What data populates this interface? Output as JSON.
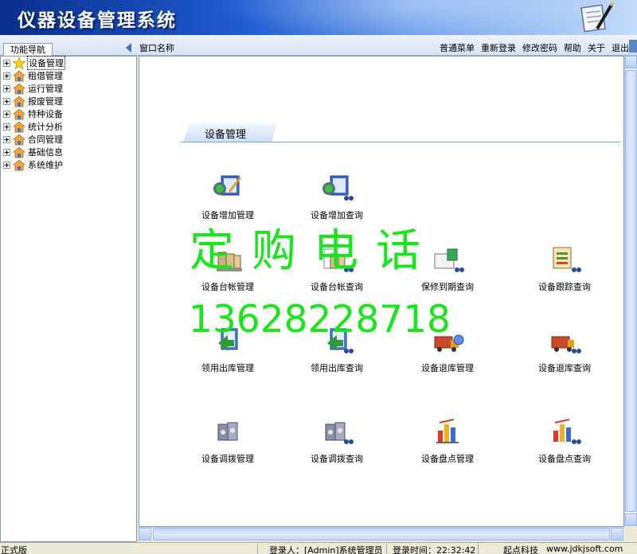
{
  "header": {
    "title": "仪器设备管理系统"
  },
  "topbar": {
    "nav_tab": "功能导航",
    "window_name": "窗口名称",
    "menu": [
      "普通菜单",
      "重新登录",
      "修改密码",
      "帮助",
      "关于",
      "退出"
    ]
  },
  "sidebar": {
    "items": [
      {
        "label": "设备管理",
        "icon": "star-icon"
      },
      {
        "label": "租借管理",
        "icon": "home-icon"
      },
      {
        "label": "运行管理",
        "icon": "home-icon"
      },
      {
        "label": "报废管理",
        "icon": "home-icon"
      },
      {
        "label": "特种设备",
        "icon": "home-icon"
      },
      {
        "label": "统计分析",
        "icon": "home-icon"
      },
      {
        "label": "合同管理",
        "icon": "home-icon"
      },
      {
        "label": "基础信息",
        "icon": "home-icon"
      },
      {
        "label": "系统维护",
        "icon": "home-icon"
      }
    ]
  },
  "main": {
    "section_title": "设备管理",
    "tiles": [
      {
        "label": "设备增加管理",
        "icon": "device-add-icon"
      },
      {
        "label": "设备增加查询",
        "icon": "device-add-query-icon"
      },
      {
        "label": "设备台帐管理",
        "icon": "ledger-icon"
      },
      {
        "label": "设备台帐查询",
        "icon": "ledger-query-icon"
      },
      {
        "label": "保修到期查询",
        "icon": "warranty-query-icon"
      },
      {
        "label": "设备跟踪查询",
        "icon": "tracking-query-icon"
      },
      {
        "label": "领用出库管理",
        "icon": "checkout-icon"
      },
      {
        "label": "领用出库查询",
        "icon": "checkout-query-icon"
      },
      {
        "label": "设备退库管理",
        "icon": "return-icon"
      },
      {
        "label": "设备退库查询",
        "icon": "return-query-icon"
      },
      {
        "label": "设备调拨管理",
        "icon": "transfer-icon"
      },
      {
        "label": "设备调拨查询",
        "icon": "transfer-query-icon"
      },
      {
        "label": "设备盘点管理",
        "icon": "inventory-icon"
      },
      {
        "label": "设备盘点查询",
        "icon": "inventory-query-icon"
      }
    ]
  },
  "watermark": {
    "line1": "定购电话",
    "line2": "13628228718"
  },
  "statusbar": {
    "edition": "正式版",
    "login_user": "登录人：[Admin]系统管理员",
    "login_time": "登录时间：22:32:42",
    "company": "起点科技",
    "website": "www.jdkjsoft.com"
  }
}
